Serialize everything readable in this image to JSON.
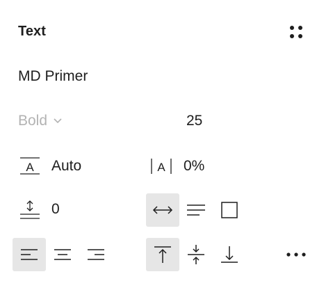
{
  "panel": {
    "title": "Text",
    "styles_icon": "four-dots-icon"
  },
  "font": {
    "family": "MD Primer",
    "weight": "Bold",
    "size": "25"
  },
  "line_height": {
    "icon": "line-height-icon",
    "value": "Auto"
  },
  "letter_spacing": {
    "icon": "letter-spacing-icon",
    "value": "0%"
  },
  "paragraph_spacing": {
    "icon": "paragraph-spacing-icon",
    "value": "0"
  },
  "resizing": {
    "options": [
      {
        "icon": "auto-width-icon",
        "active": true
      },
      {
        "icon": "auto-height-icon",
        "active": false
      },
      {
        "icon": "fixed-size-icon",
        "active": false
      }
    ]
  },
  "horizontal_align": {
    "options": [
      {
        "icon": "align-left-icon",
        "active": true
      },
      {
        "icon": "align-center-icon",
        "active": false
      },
      {
        "icon": "align-right-icon",
        "active": false
      }
    ]
  },
  "vertical_align": {
    "options": [
      {
        "icon": "align-top-icon",
        "active": true
      },
      {
        "icon": "align-middle-icon",
        "active": false
      },
      {
        "icon": "align-bottom-icon",
        "active": false
      }
    ]
  },
  "more_icon": "more-options-icon",
  "colors": {
    "text": "#1e1e1e",
    "muted": "#b3b3b3",
    "active_bg": "#e6e6e6"
  }
}
